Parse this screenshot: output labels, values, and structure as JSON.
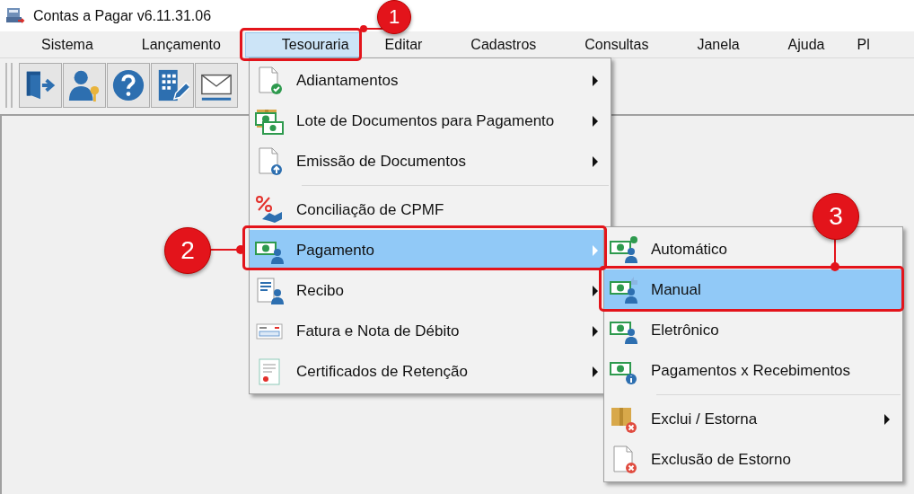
{
  "window": {
    "title": "Contas a Pagar v6.11.31.06"
  },
  "menu_bar": [
    {
      "label": "Sistema",
      "selected": false
    },
    {
      "label": "Lançamento",
      "selected": false
    },
    {
      "label": "Tesouraria",
      "selected": true
    },
    {
      "label": "Editar",
      "selected": false
    },
    {
      "label": "Cadastros",
      "selected": false
    },
    {
      "label": "Consultas",
      "selected": false
    },
    {
      "label": "Janela",
      "selected": false
    },
    {
      "label": "Ajuda",
      "selected": false
    },
    {
      "label": "Pl",
      "selected": false
    }
  ],
  "menu": {
    "items": [
      {
        "kind": "item",
        "label": "Adiantamentos",
        "submenu": true,
        "selected": false
      },
      {
        "kind": "item",
        "label": "Lote de Documentos para Pagamento",
        "submenu": true,
        "selected": false
      },
      {
        "kind": "item",
        "label": "Emissão de Documentos",
        "submenu": true,
        "selected": false
      },
      {
        "kind": "separator"
      },
      {
        "kind": "item",
        "label": "Conciliação de CPMF",
        "submenu": false,
        "selected": false
      },
      {
        "kind": "item",
        "label": "Pagamento",
        "submenu": true,
        "selected": true
      },
      {
        "kind": "item",
        "label": "Recibo",
        "submenu": true,
        "selected": false
      },
      {
        "kind": "item",
        "label": "Fatura e Nota de Débito",
        "submenu": true,
        "selected": false
      },
      {
        "kind": "item",
        "label": "Certificados de Retenção",
        "submenu": true,
        "selected": false
      }
    ]
  },
  "submenu": {
    "items": [
      {
        "kind": "item",
        "label": "Automático",
        "submenu": false,
        "selected": false
      },
      {
        "kind": "item",
        "label": "Manual",
        "submenu": false,
        "selected": true
      },
      {
        "kind": "item",
        "label": "Eletrônico",
        "submenu": false,
        "selected": false
      },
      {
        "kind": "item",
        "label": "Pagamentos x Recebimentos",
        "submenu": false,
        "selected": false
      },
      {
        "kind": "separator"
      },
      {
        "kind": "item",
        "label": "Exclui / Estorna",
        "submenu": true,
        "selected": false
      },
      {
        "kind": "item",
        "label": "Exclusão de Estorno",
        "submenu": false,
        "selected": false
      }
    ]
  },
  "callouts": [
    {
      "label": "1"
    },
    {
      "label": "2"
    },
    {
      "label": "3"
    }
  ]
}
